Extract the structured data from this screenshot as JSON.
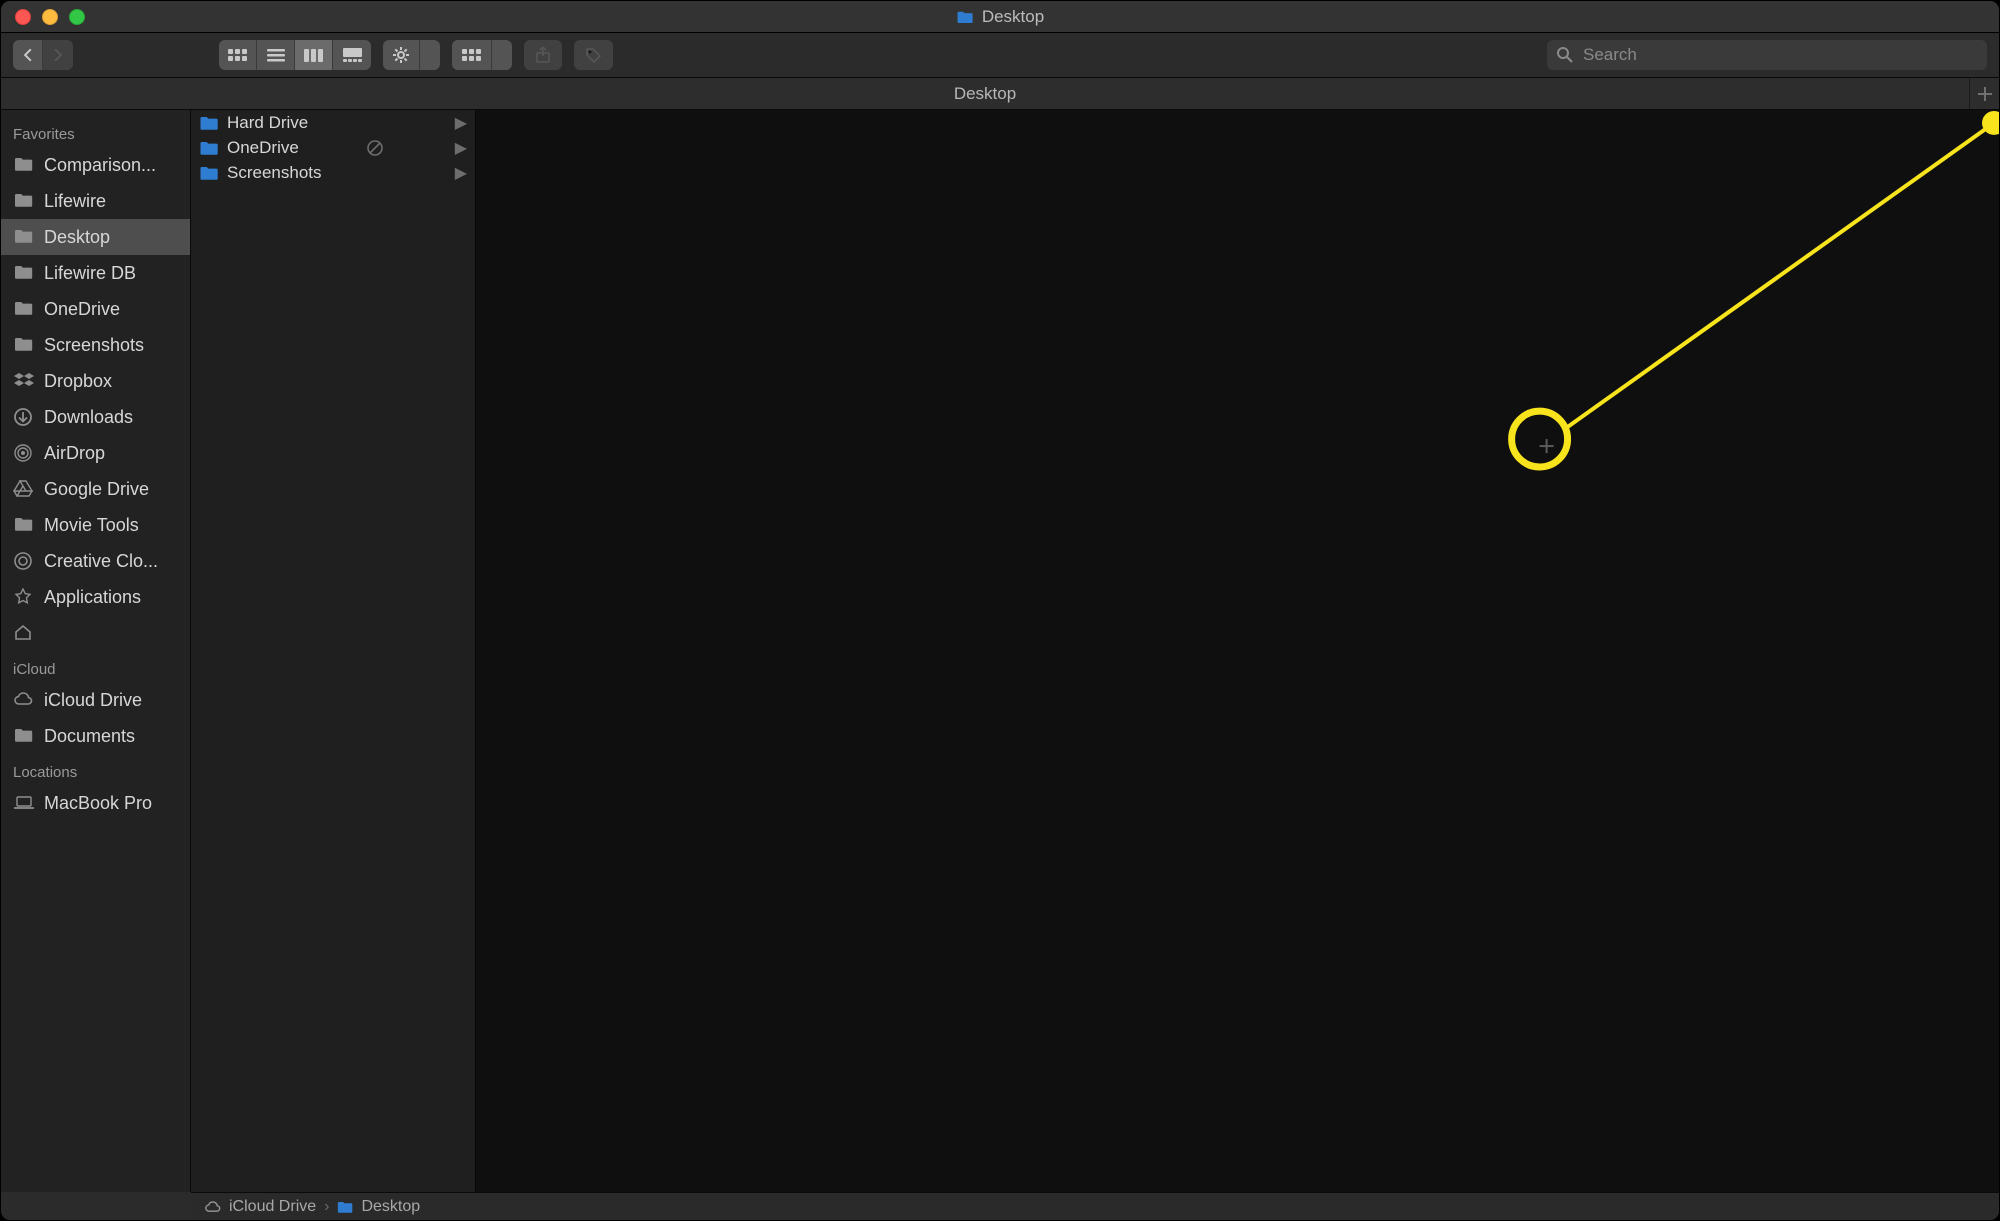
{
  "window": {
    "title": "Desktop"
  },
  "toolbar": {
    "search_placeholder": "Search"
  },
  "tabbar": {
    "tab_label": "Desktop"
  },
  "sidebar": {
    "sections": [
      {
        "header": "Favorites",
        "items": [
          {
            "label": "Comparison...",
            "icon": "folder",
            "selected": false
          },
          {
            "label": "Lifewire",
            "icon": "folder",
            "selected": false
          },
          {
            "label": "Desktop",
            "icon": "folder",
            "selected": true
          },
          {
            "label": "Lifewire DB",
            "icon": "folder",
            "selected": false
          },
          {
            "label": "OneDrive",
            "icon": "folder",
            "selected": false
          },
          {
            "label": "Screenshots",
            "icon": "folder",
            "selected": false
          },
          {
            "label": "Dropbox",
            "icon": "dropbox",
            "selected": false
          },
          {
            "label": "Downloads",
            "icon": "downloads",
            "selected": false
          },
          {
            "label": "AirDrop",
            "icon": "airdrop",
            "selected": false
          },
          {
            "label": "Google Drive",
            "icon": "gdrive",
            "selected": false
          },
          {
            "label": "Movie Tools",
            "icon": "folder",
            "selected": false
          },
          {
            "label": "Creative Clo...",
            "icon": "cc",
            "selected": false
          },
          {
            "label": "Applications",
            "icon": "apps",
            "selected": false
          },
          {
            "label": " ",
            "icon": "home",
            "selected": false,
            "blurred": true
          }
        ]
      },
      {
        "header": "iCloud",
        "items": [
          {
            "label": "iCloud Drive",
            "icon": "icloud",
            "selected": false
          },
          {
            "label": "Documents",
            "icon": "folder",
            "selected": false
          }
        ]
      },
      {
        "header": "Locations",
        "items": [
          {
            "label": "MacBook Pro",
            "icon": "laptop",
            "selected": false
          }
        ]
      }
    ]
  },
  "column": {
    "items": [
      {
        "label": "Hard Drive",
        "has_children": true,
        "sync_off": false
      },
      {
        "label": "OneDrive",
        "has_children": true,
        "sync_off": true
      },
      {
        "label": "Screenshots",
        "has_children": true,
        "sync_off": false
      }
    ]
  },
  "pathbar": {
    "segments": [
      {
        "label": "iCloud Drive",
        "icon": "icloud"
      },
      {
        "label": "Desktop",
        "icon": "folder"
      }
    ]
  },
  "annotation": {
    "color": "#f8e41c",
    "target_plus": true,
    "line_from_corner": true
  }
}
